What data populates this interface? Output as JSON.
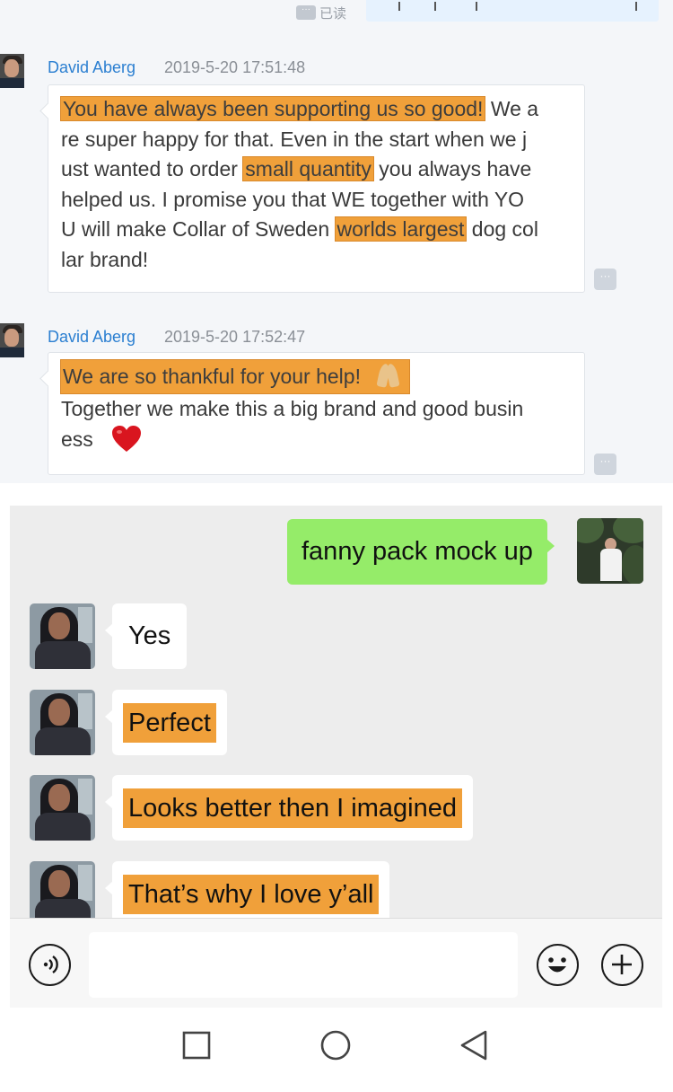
{
  "top_panel": {
    "read_status": "已读",
    "messages": [
      {
        "sender": "David Aberg",
        "timestamp": "2019-5-20 17:51:48",
        "lines": [
          [
            {
              "t": "You have always been supporting us so good!",
              "hl": true
            },
            {
              "t": " We a",
              "hl": false
            }
          ],
          [
            {
              "t": "re super happy for that. Even in the start when we j",
              "hl": false
            }
          ],
          [
            {
              "t": "ust wanted to order ",
              "hl": false
            },
            {
              "t": "small quantity",
              "hl": true
            },
            {
              "t": " you always have",
              "hl": false
            }
          ],
          [
            {
              "t": "helped us. I promise you that WE together with YO",
              "hl": false
            }
          ],
          [
            {
              "t": "U will make Collar of Sweden ",
              "hl": false
            },
            {
              "t": "worlds largest",
              "hl": true
            },
            {
              "t": " dog col",
              "hl": false
            }
          ],
          [
            {
              "t": "lar brand!",
              "hl": false
            }
          ]
        ]
      },
      {
        "sender": "David Aberg",
        "timestamp": "2019-5-20 17:52:47",
        "line1": "We are so thankful for your help!",
        "line1_emoji": "folded-hands-emoji",
        "line2": "Together we make this a big brand and good busin",
        "line3": "ess",
        "line3_emoji": "red-heart-emoji"
      }
    ]
  },
  "phone": {
    "outgoing_message": "fanny pack mock up",
    "incoming_messages": [
      {
        "text": "Yes",
        "highlighted": false
      },
      {
        "text": "Perfect",
        "highlighted": true
      },
      {
        "text": "Looks better then I imagined",
        "highlighted": true
      },
      {
        "text": "That’s why I love y’all",
        "highlighted": true
      }
    ],
    "input_bar": {
      "voice_icon": "voice-input-icon",
      "emoji_icon": "emoji-icon",
      "plus_icon": "plus-icon"
    },
    "nav": [
      "recent-apps-icon",
      "home-icon",
      "back-icon"
    ]
  },
  "colors": {
    "highlight": "#f0a03a",
    "sender_name": "#2b7fd1",
    "outgoing_bubble": "#95ec69",
    "chat_background": "#ededed"
  }
}
